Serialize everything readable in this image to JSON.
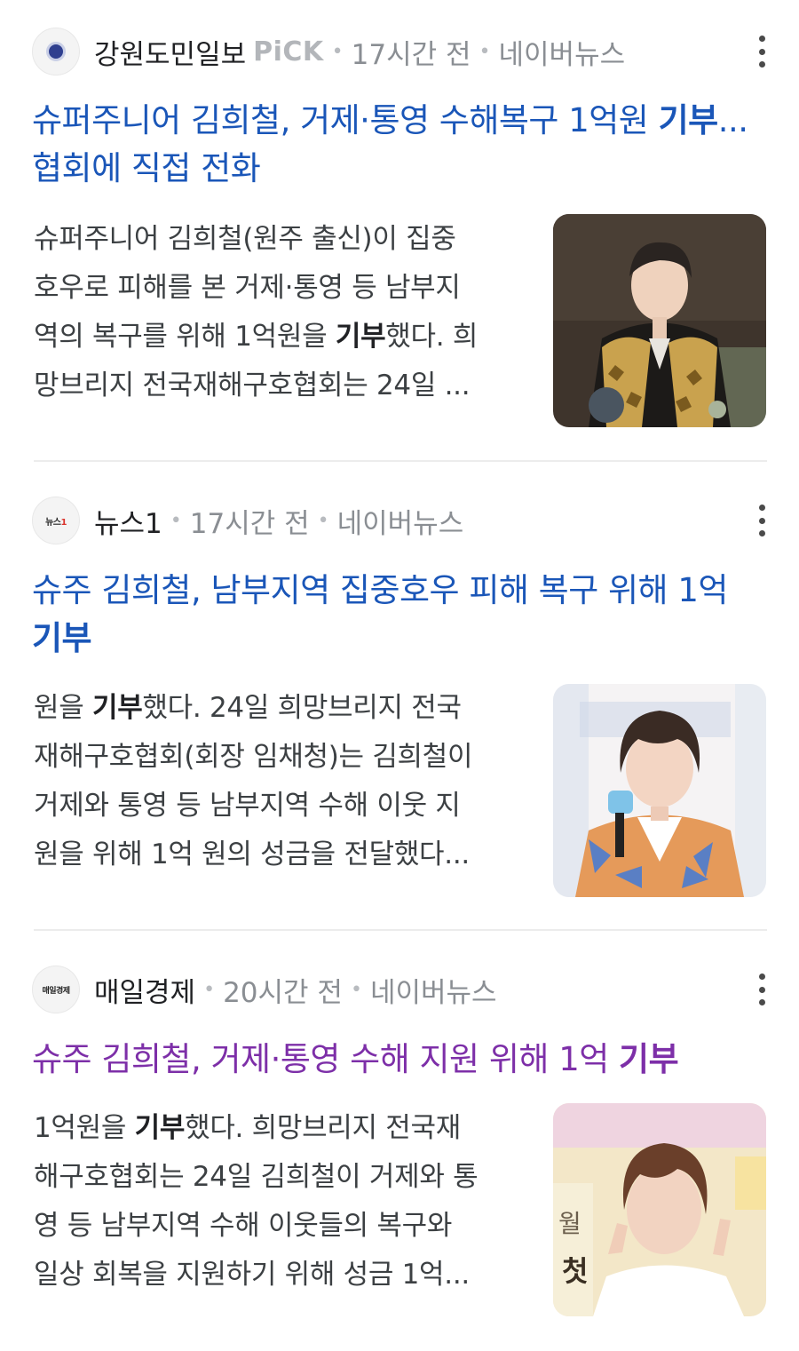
{
  "results": [
    {
      "source": "강원도민일보",
      "pick": "PiCK",
      "time": "17시간 전",
      "platform": "네이버뉴스",
      "title_lines": [
        "슈퍼주니어 김희철, 거제·통영 수해복구 1억원 ",
        "기부",
        "...",
        "협회에 직접 전화"
      ],
      "snippet_lines": [
        "슈퍼주니어 김희철(원주 출신)이 집중",
        "호우로 피해를 본 거제·통영 등 남부지",
        "역의 복구를 위해 1억원을 ",
        "기부",
        "했다. 희",
        "망브리지 전국재해구호협회는 24일 ..."
      ],
      "thumb": "김희철 photo, gold patterned jacket"
    },
    {
      "source": "뉴스1",
      "logo_text": "뉴스",
      "logo_num": "1",
      "time": "17시간 전",
      "platform": "네이버뉴스",
      "title_lines": [
        "슈주 김희철, 남부지역 집중호우 피해 복구 위해 1억",
        "기부"
      ],
      "snippet_lines": [
        "원을 ",
        "기부",
        "했다. 24일 희망브리지 전국",
        "재해구호협회(회장 임채청)는 김희철이",
        "거제와 통영 등 남부지역 수해 이웃 지",
        "원을 위해 1억 원의 성금을 전달했다..."
      ]
    },
    {
      "source": "매일경제",
      "logo_text": "매일경제",
      "time": "20시간 전",
      "platform": "네이버뉴스",
      "title_lines": [
        "슈주 김희철, 거제·통영 수해 지원 위해 1억 ",
        "기부"
      ],
      "snippet_lines": [
        "1억원을 ",
        "기부",
        "했다. 희망브리지 전국재",
        "해구호협회는 24일 김희철이 거제와 통",
        "영 등 남부지역 수해 이웃들의 복구와",
        "일상 회복을 지원하기 위해 성금 1억..."
      ],
      "thumb_text": [
        "월",
        "첫"
      ]
    }
  ],
  "colors": {
    "title_link": "#1a56b8",
    "title_visited": "#7d2fa8",
    "meta": "#8a8e93"
  },
  "icons": [
    "more-vert-icon"
  ]
}
